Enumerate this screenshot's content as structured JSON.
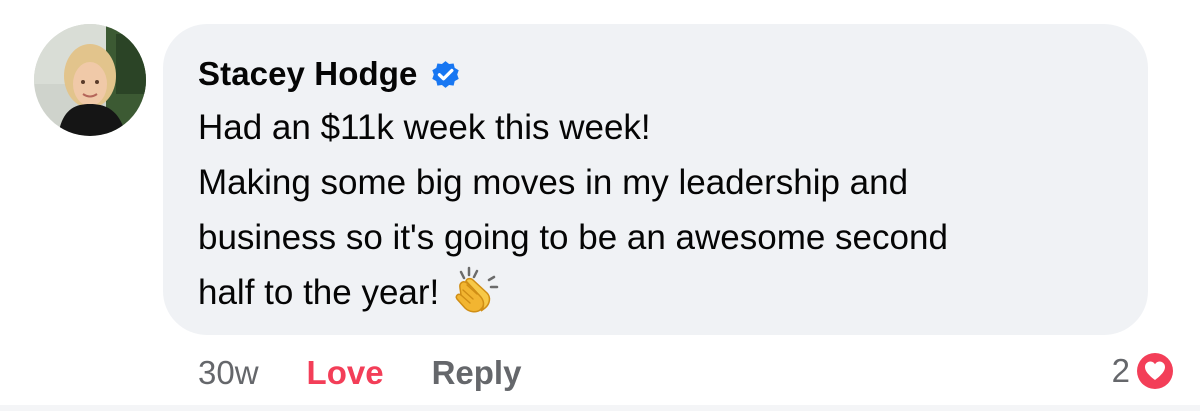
{
  "comment": {
    "author": "Stacey Hodge",
    "verified": true,
    "lines": [
      "Had an $11k week this week!",
      "Making some big moves in my leadership and",
      "business so it's going to be an awesome second",
      "half to the year!"
    ],
    "emoji": "clapping-hands-emoji"
  },
  "actions": {
    "timestamp": "30w",
    "reaction_label": "Love",
    "reply_label": "Reply"
  },
  "reactions": {
    "count": "2",
    "icon": "heart-icon"
  },
  "colors": {
    "bubble": "#f0f2f5",
    "verified": "#1877f2",
    "love": "#f33e58",
    "muted": "#65676b",
    "text": "#050505"
  }
}
